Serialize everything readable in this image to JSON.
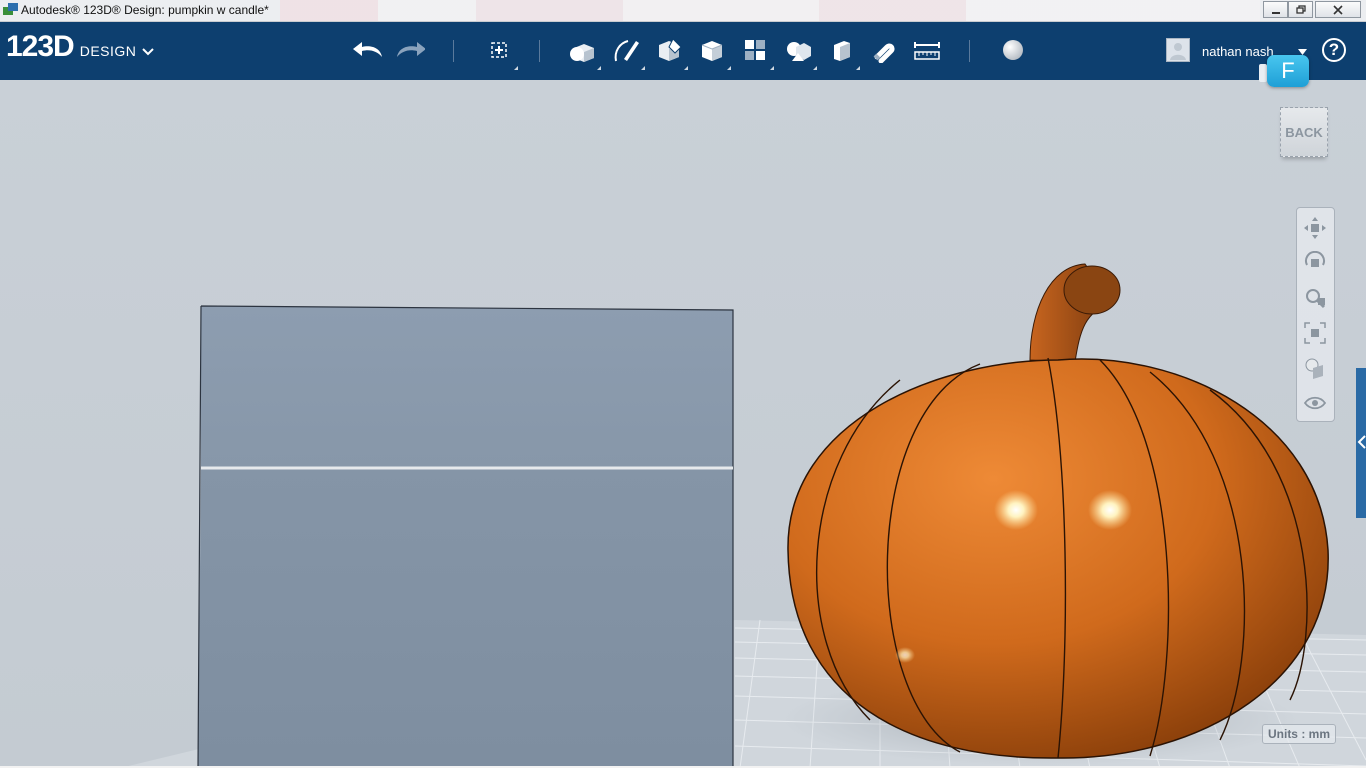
{
  "window": {
    "title": "Autodesk® 123D® Design: pumpkin w candle*",
    "controls": [
      "minimize",
      "restore",
      "close"
    ]
  },
  "app": {
    "logo_number": "123D",
    "logo_word": "DESIGN"
  },
  "toolbar": {
    "icons": [
      "undo-icon",
      "redo-icon",
      "transform-icon",
      "primitives-icon",
      "sketch-icon",
      "construct-icon",
      "modify-icon",
      "pattern-icon",
      "grouping-icon",
      "combine-icon",
      "snap-icon",
      "measure-icon",
      "material-icon"
    ]
  },
  "user": {
    "name": "nathan nash",
    "help_label": "?"
  },
  "badge": {
    "label": "F"
  },
  "viewcube": {
    "face_label": "BACK"
  },
  "navigation": {
    "tools": [
      "pan-icon",
      "orbit-icon",
      "zoom-icon",
      "fit-icon",
      "view-mode-icon",
      "visibility-icon"
    ]
  },
  "status": {
    "units_label": "Units : mm"
  },
  "colors": {
    "toolbar": "#0d3f6f",
    "pumpkin": "#d06a1c",
    "box": "#8898aa",
    "viewport": "#c6cdd4"
  }
}
